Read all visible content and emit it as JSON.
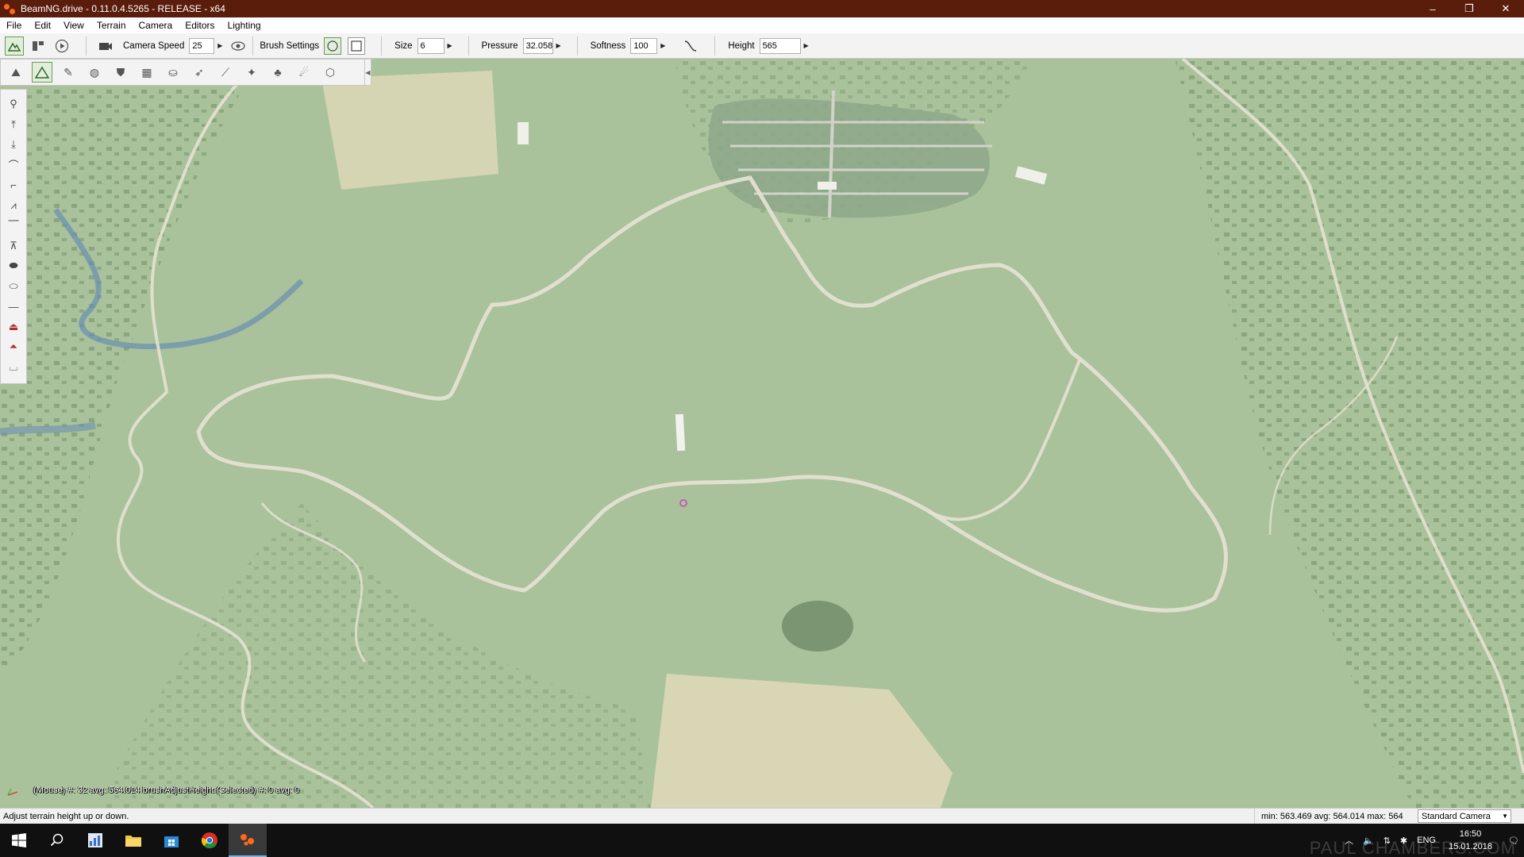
{
  "window": {
    "title": "BeamNG.drive - 0.11.0.4.5265 - RELEASE - x64",
    "controls": {
      "minimize": "–",
      "restore": "❐",
      "close": "✕"
    }
  },
  "menu": [
    "File",
    "Edit",
    "View",
    "Terrain",
    "Camera",
    "Editors",
    "Lighting"
  ],
  "toolbar": {
    "camera_speed_label": "Camera Speed",
    "camera_speed_value": "25",
    "brush_settings_label": "Brush Settings",
    "size_label": "Size",
    "size_value": "6",
    "pressure_label": "Pressure",
    "pressure_value": "32.058",
    "softness_label": "Softness",
    "softness_value": "100",
    "height_label": "Height",
    "height_value": "565"
  },
  "viewport": {
    "debug_text": "(Mouse) #: 32  avg: 564.014 brushAdjustHeight   (Selected) #: 0  avg: 0"
  },
  "statusbar": {
    "message": "Adjust terrain height up or down.",
    "height_stats": "min: 563.469  avg: 564.014  max: 564",
    "camera_mode": "Standard Camera"
  },
  "taskbar": {
    "tray_language": "ENG",
    "clock_time": "16:50",
    "clock_date": "15.01.2018",
    "watermark": "PAUL CHAMBERS.COM"
  },
  "colors": {
    "titlebar": "#5a1d0c",
    "terrain": "#a9c29b",
    "road": "#e4e2d2",
    "field": "#ddd8b8"
  }
}
